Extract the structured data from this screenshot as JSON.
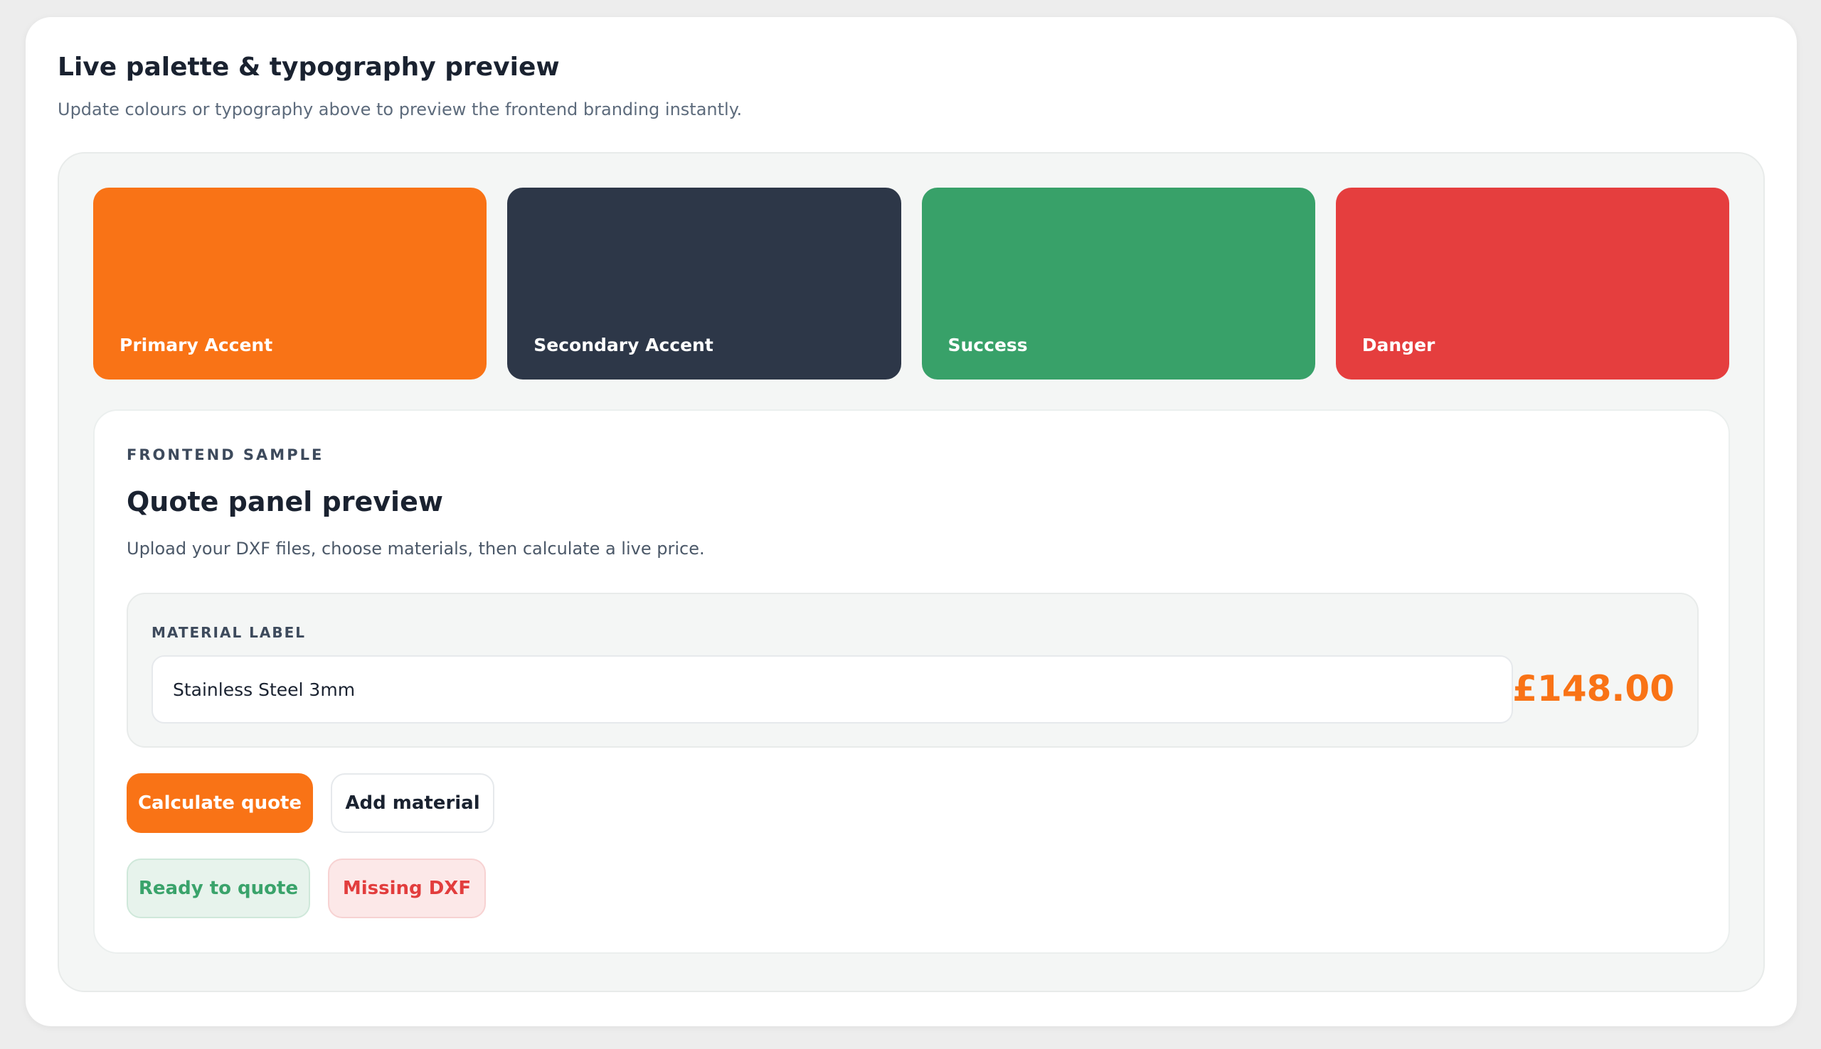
{
  "header": {
    "title": "Live palette & typography preview",
    "subtitle": "Update colours or typography above to preview the frontend branding instantly."
  },
  "palette": [
    {
      "label": "Primary Accent",
      "color": "#f97316"
    },
    {
      "label": "Secondary Accent",
      "color": "#2d3748"
    },
    {
      "label": "Success",
      "color": "#38a169"
    },
    {
      "label": "Danger",
      "color": "#e53e3e"
    }
  ],
  "sample": {
    "eyebrow": "FRONTEND SAMPLE",
    "title": "Quote panel preview",
    "description": "Upload your DXF files, choose materials, then calculate a live price.",
    "material_label": "MATERIAL LABEL",
    "material_value": "Stainless Steel 3mm",
    "price": "£148.00",
    "primary_button": "Calculate quote",
    "secondary_button": "Add material",
    "badge_success": "Ready to quote",
    "badge_danger": "Missing DXF"
  }
}
